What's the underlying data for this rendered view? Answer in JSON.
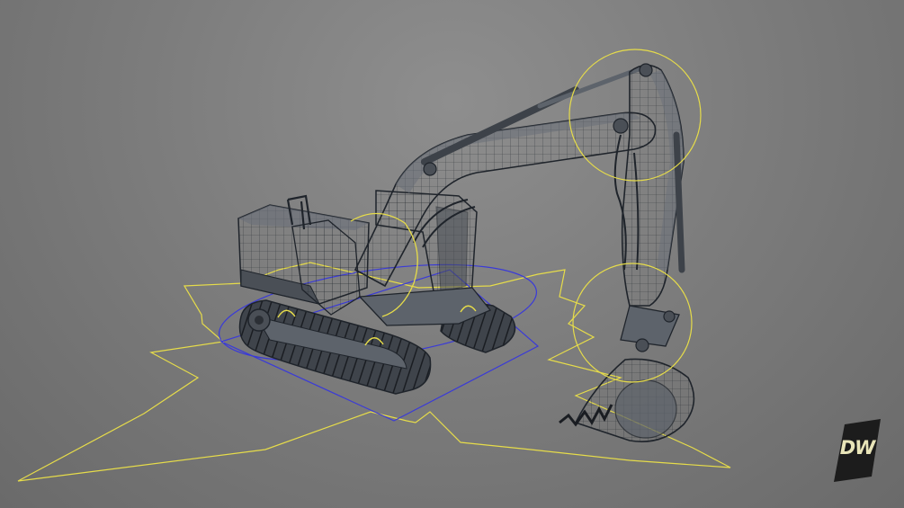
{
  "viewport": {
    "background_color": "#7d7d7d"
  },
  "model": {
    "subject": "excavator-wireframe",
    "wire_color": "#1f242b",
    "body_color": "#5d636b",
    "body_shade_color": "#4a4f56"
  },
  "rig": {
    "control_color": "#e6dc4a",
    "base_control_color": "#3a3ad8",
    "joint_controls": [
      "boom-base-joint",
      "boom-arm-joint",
      "arm-bucket-joint",
      "track-wheel-joint"
    ]
  },
  "logo": {
    "text": "DW",
    "text_color": "#e8e4b8",
    "badge_color": "#1c1c1c",
    "icon": "dw-logo-icon"
  }
}
